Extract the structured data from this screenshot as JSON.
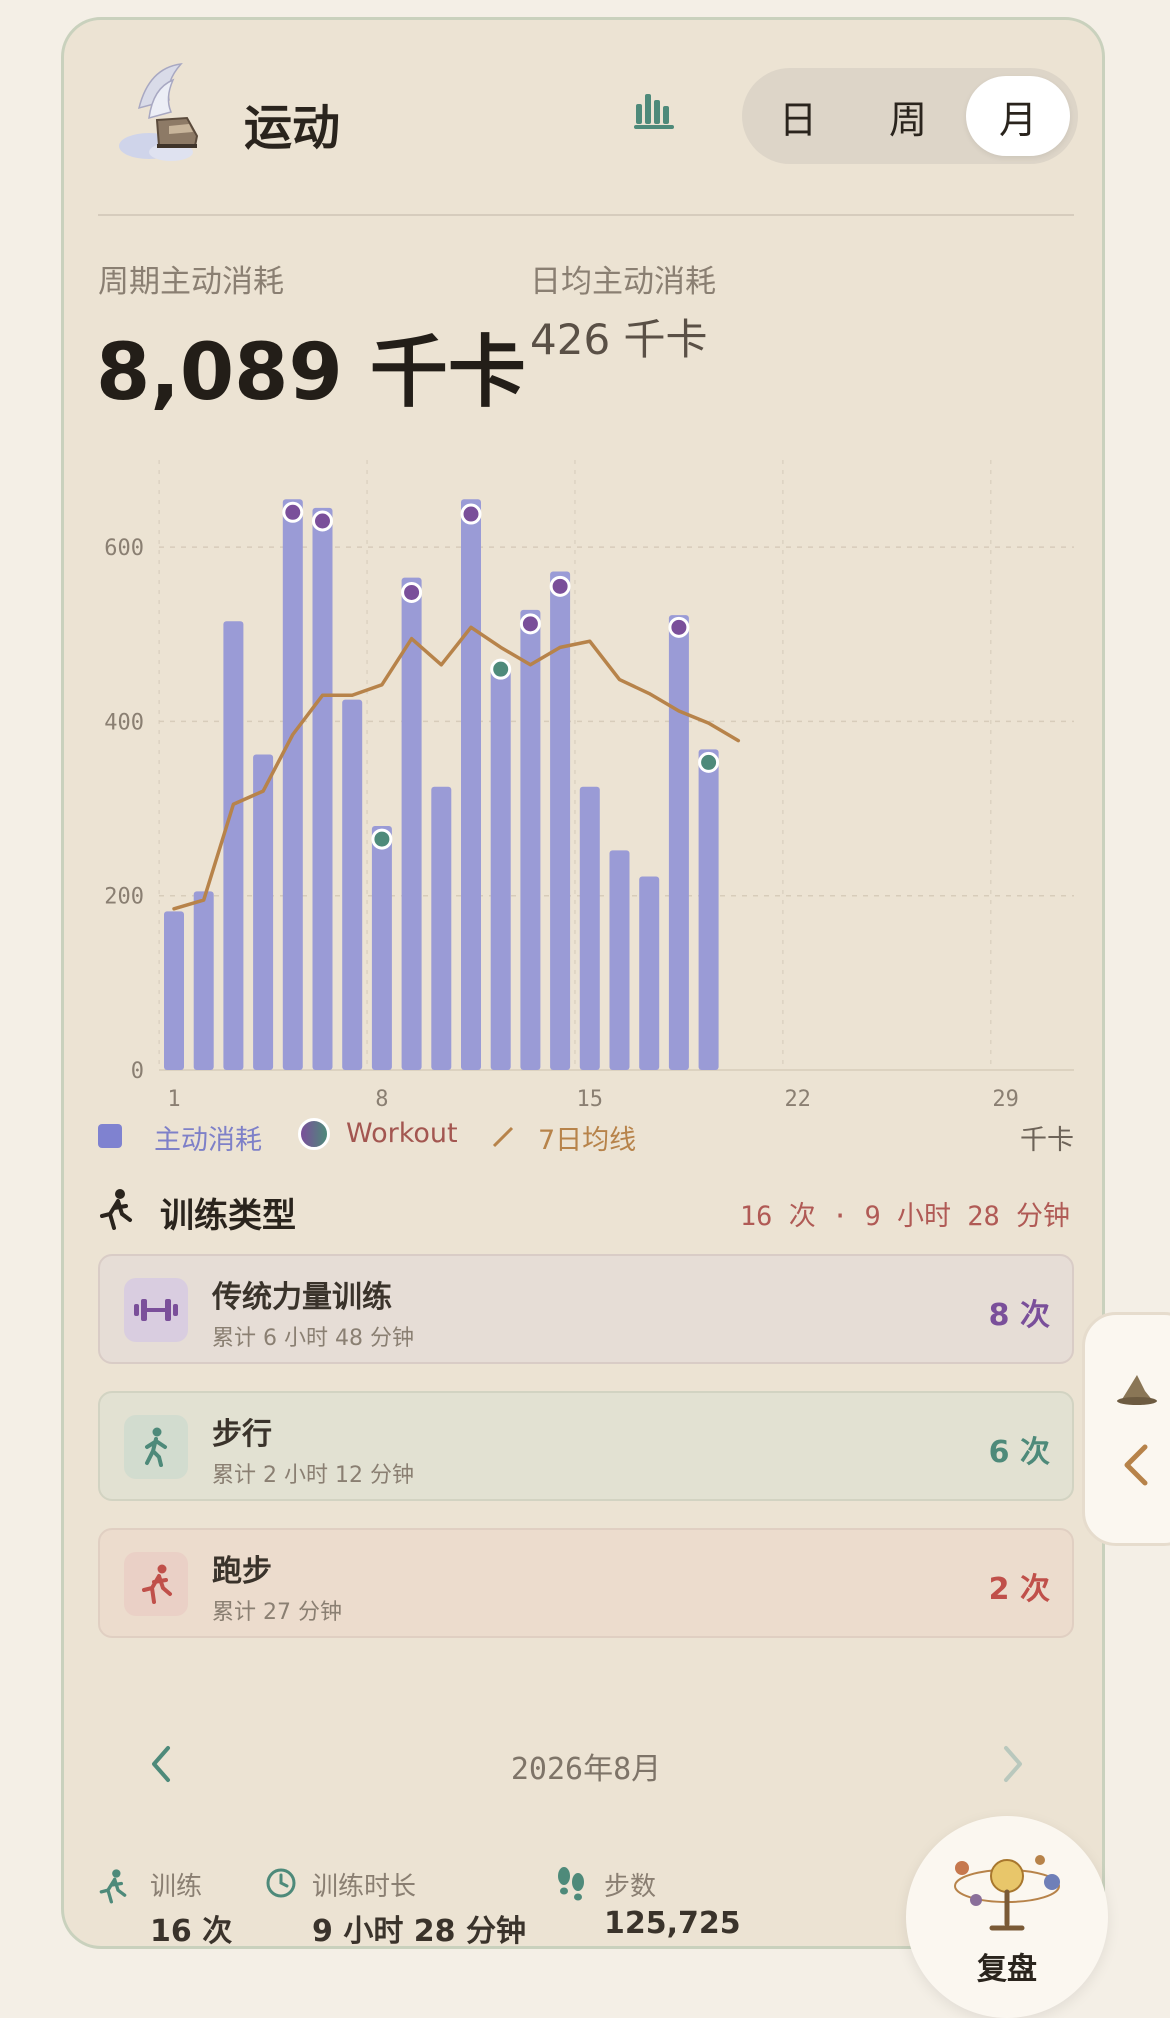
{
  "header": {
    "title": "运动",
    "segments": [
      "日",
      "周",
      "月"
    ],
    "active_segment": "月"
  },
  "summary": {
    "total_label": "周期主动消耗",
    "total_value": "8,089 千卡",
    "avg_label": "日均主动消耗",
    "avg_value": "426 千卡"
  },
  "chart_data": {
    "type": "bar",
    "x_ticks": [
      "1",
      "8",
      "15",
      "22",
      "29"
    ],
    "y_ticks": [
      "0",
      "200",
      "400",
      "600"
    ],
    "ylim": [
      0,
      700
    ],
    "xlim": [
      1,
      31
    ],
    "grid": true,
    "unit": "千卡",
    "series": [
      {
        "name": "主动消耗",
        "x": [
          1,
          2,
          3,
          4,
          5,
          6,
          7,
          8,
          9,
          10,
          11,
          12,
          13,
          14,
          15,
          16,
          17,
          18,
          19
        ],
        "values": [
          182,
          205,
          515,
          362,
          655,
          645,
          425,
          280,
          565,
          325,
          655,
          460,
          528,
          572,
          325,
          252,
          222,
          522,
          368
        ]
      },
      {
        "name": "Workout",
        "x": [
          5,
          6,
          8,
          9,
          11,
          12,
          13,
          14,
          18,
          19
        ],
        "values": [
          640,
          630,
          265,
          548,
          638,
          460,
          512,
          555,
          508,
          353
        ]
      },
      {
        "name": "7日均线",
        "x": [
          1,
          2,
          3,
          4,
          5,
          6,
          7,
          8,
          9,
          10,
          11,
          12,
          13,
          14,
          15,
          16,
          17,
          18,
          19,
          20
        ],
        "values": [
          185,
          195,
          305,
          320,
          385,
          430,
          430,
          442,
          495,
          465,
          508,
          485,
          465,
          485,
          492,
          448,
          432,
          412,
          398,
          378
        ]
      }
    ],
    "legend": [
      "主动消耗",
      "Workout",
      "7日均线"
    ]
  },
  "training": {
    "heading": "训练类型",
    "summary": "16 次 · 9 小时 28 分钟",
    "items": [
      {
        "name": "传统力量训练",
        "sub": "累计 6 小时 48 分钟",
        "count": "8 次"
      },
      {
        "name": "步行",
        "sub": "累计 2 小时 12 分钟",
        "count": "6 次"
      },
      {
        "name": "跑步",
        "sub": "累计 27 分钟",
        "count": "2 次"
      }
    ]
  },
  "period": {
    "label": "2026年8月"
  },
  "footer": {
    "workouts_label": "训练",
    "workouts_value": "16 次",
    "duration_label": "训练时长",
    "duration_value": "9 小时 28 分钟",
    "steps_label": "步数",
    "steps_value": "125,725",
    "review_label": "复盘"
  },
  "colors": {
    "bar": "#9a9bd6",
    "avg_line": "#b7834a",
    "strength": "#7a4f9a",
    "walk": "#4e8a7a",
    "run": "#c0504a"
  }
}
